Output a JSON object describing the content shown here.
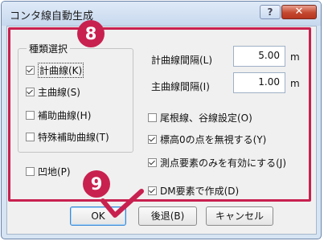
{
  "window": {
    "title": "コンタ線自動生成",
    "help": "?",
    "close": "✕"
  },
  "kinds_group": {
    "title": "種類選択",
    "items": [
      {
        "label": "計曲線(K)",
        "checked": true
      },
      {
        "label": "主曲線(S)",
        "checked": true
      },
      {
        "label": "補助曲線(H)",
        "checked": false
      },
      {
        "label": "特殊補助曲線(T)",
        "checked": false
      }
    ]
  },
  "depression": {
    "label": "凹地(P)",
    "checked": false
  },
  "intervals": {
    "index_label": "計曲線間隔(L)",
    "index_value": "5.00",
    "main_label": "主曲線間隔(I)",
    "main_value": "1.00",
    "unit": "m"
  },
  "options": [
    {
      "label": "尾根線、谷線設定(O)",
      "checked": false
    },
    {
      "label": "標高0の点を無視する(Y)",
      "checked": true
    },
    {
      "label": "測点要素のみを有効にする(J)",
      "checked": true
    },
    {
      "label": "DM要素で作成(D)",
      "checked": true
    }
  ],
  "buttons": {
    "ok": "OK",
    "back": "後退(B)",
    "cancel": "キャンセル"
  },
  "annotations": {
    "step8": "8",
    "step9": "9",
    "accent": "#c8214f"
  }
}
